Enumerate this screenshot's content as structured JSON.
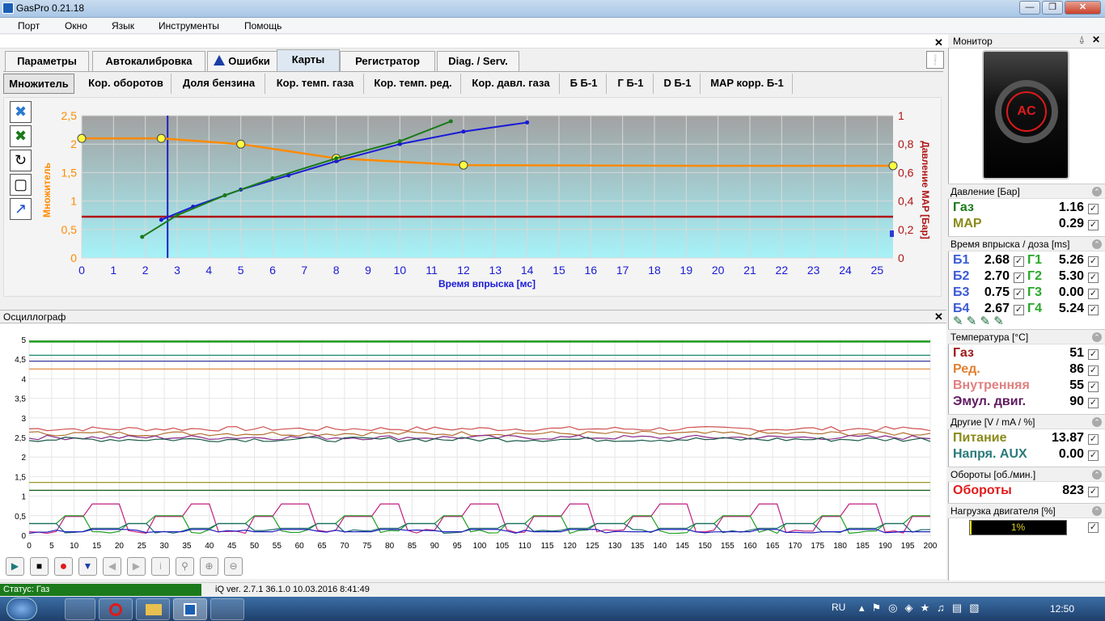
{
  "window": {
    "title": "GasPro 0.21.18"
  },
  "menu": [
    "Порт",
    "Окно",
    "Язык",
    "Инструменты",
    "Помощь"
  ],
  "main_tabs": [
    "Параметры",
    "Автокалибровка",
    "Ошибки",
    "Карты",
    "Регистратор",
    "Diag. / Serv."
  ],
  "active_main_tab": "Карты",
  "sub_tabs": [
    "Множитель",
    "Кор. оборотов",
    "Доля бензина",
    "Кор. темп. газа",
    "Кор. темп. ред.",
    "Кор. давл. газа",
    "Б Б-1",
    "Г Б-1",
    "D Б-1",
    "MAP корр. Б-1"
  ],
  "active_sub_tab": "Множитель",
  "chart_data": {
    "type": "line",
    "xlabel": "Время впрыска [мс]",
    "ylabel": "Множитель",
    "y2label": "Давление MAP [Бар]",
    "x_ticks": [
      "0",
      "1",
      "2",
      "3",
      "4",
      "5",
      "6",
      "7",
      "8",
      "9",
      "10",
      "11",
      "12",
      "13",
      "14",
      "15",
      "16",
      "17",
      "18",
      "19",
      "20",
      "21",
      "22",
      "23",
      "24",
      "25"
    ],
    "y_ticks": [
      "0",
      "0,5",
      "1",
      "1,5",
      "2",
      "2,5"
    ],
    "y2_ticks": [
      "0",
      "0,2",
      "0,4",
      "0,6",
      "0,8",
      "1"
    ],
    "xlim": [
      0,
      25.5
    ],
    "ylim": [
      0,
      2.5
    ],
    "y2lim": [
      0,
      1
    ],
    "series": [
      {
        "points": [
          [
            0,
            2.1
          ],
          [
            2.5,
            2.1
          ],
          [
            5,
            2.0
          ],
          [
            8,
            1.75
          ],
          [
            12,
            1.63
          ],
          [
            19,
            1.62
          ],
          [
            25.5,
            1.62
          ]
        ],
        "color": "#ff8a00"
      },
      {
        "points": [
          [
            2.5,
            0.67
          ],
          [
            3.5,
            0.9
          ],
          [
            5,
            1.2
          ],
          [
            6.5,
            1.45
          ],
          [
            8,
            1.7
          ],
          [
            10,
            2.0
          ],
          [
            12,
            2.22
          ],
          [
            14,
            2.38
          ]
        ],
        "color": "#1a1ad6"
      },
      {
        "points": [
          [
            1.9,
            0.37
          ],
          [
            3,
            0.75
          ],
          [
            4.5,
            1.1
          ],
          [
            6,
            1.4
          ],
          [
            8,
            1.75
          ],
          [
            10,
            2.05
          ],
          [
            11.6,
            2.4
          ]
        ],
        "color": "#1a7a1a"
      }
    ],
    "map_pressure_line": 0.29,
    "cursor_x": 2.7,
    "colors": {
      "plot_top": "#a2a2a2",
      "plot_bottom": "#a6f2f8",
      "multiplier_curve": "#ff8a00",
      "map_line": "#b01414",
      "cursor": "#2020c0"
    }
  },
  "oscillograph": {
    "title": "Осциллограф",
    "chart_data": {
      "type": "line",
      "y_ticks": [
        "0",
        "0,5",
        "1",
        "1,5",
        "2",
        "2,5",
        "3",
        "3,5",
        "4",
        "4,5",
        "5"
      ],
      "x_ticks": [
        "0",
        "5",
        "10",
        "15",
        "20",
        "25",
        "30",
        "35",
        "40",
        "45",
        "50",
        "55",
        "60",
        "65",
        "70",
        "75",
        "80",
        "85",
        "90",
        "95",
        "100",
        "105",
        "110",
        "115",
        "120",
        "125",
        "130",
        "135",
        "140",
        "145",
        "150",
        "155",
        "160",
        "165",
        "170",
        "175",
        "180",
        "185",
        "190",
        "195",
        "200"
      ],
      "xlim": [
        0,
        200
      ],
      "ylim": [
        0,
        5
      ],
      "levels": [
        {
          "y": 4.95,
          "color": "#1a9a1a"
        },
        {
          "y": 4.6,
          "color": "#1a8a6a"
        },
        {
          "y": 4.45,
          "color": "#3a3aa0"
        },
        {
          "y": 4.25,
          "color": "#e08030"
        },
        {
          "y": 2.72,
          "color": "#d05050"
        },
        {
          "y": 2.6,
          "color": "#b07030"
        },
        {
          "y": 2.5,
          "color": "#8a2a8a"
        },
        {
          "y": 2.45,
          "color": "#1a5a4a"
        },
        {
          "y": 1.35,
          "color": "#9a9a20"
        },
        {
          "y": 1.15,
          "color": "#1a5a1a"
        },
        {
          "y": 0.8,
          "color": "#c02080"
        },
        {
          "y": 0.5,
          "color": "#20a020"
        },
        {
          "y": 0.3,
          "color": "#1a6a6a"
        },
        {
          "y": 0.15,
          "color": "#2020c0"
        }
      ]
    },
    "controls": [
      "play",
      "stop",
      "record",
      "down",
      "prev",
      "next",
      "info",
      "zoom",
      "zoom-in",
      "zoom-out"
    ]
  },
  "monitor": {
    "title": "Монитор",
    "pressure": {
      "header": "Давление [Бар]",
      "items": [
        {
          "label": "Газ",
          "value": "1.16",
          "color": "#1a7a1a"
        },
        {
          "label": "MAP",
          "value": "0.29",
          "color": "#8a8a1a"
        }
      ]
    },
    "injection": {
      "header": "Время впрыска / доза [ms]",
      "rows": [
        {
          "b": "Б1",
          "bv": "2.68",
          "g": "Г1",
          "gv": "5.26"
        },
        {
          "b": "Б2",
          "bv": "2.70",
          "g": "Г2",
          "gv": "5.30"
        },
        {
          "b": "Б3",
          "bv": "0.75",
          "g": "Г3",
          "gv": "0.00"
        },
        {
          "b": "Б4",
          "bv": "2.67",
          "g": "Г4",
          "gv": "5.24"
        }
      ]
    },
    "temperature": {
      "header": "Температура [°C]",
      "items": [
        {
          "label": "Газ",
          "value": "51",
          "color": "#a01a1a"
        },
        {
          "label": "Ред.",
          "value": "86",
          "color": "#e08030"
        },
        {
          "label": "Внутренняя",
          "value": "55",
          "color": "#e08080"
        },
        {
          "label": "Эмул. двиг.",
          "value": "90",
          "color": "#601a60"
        }
      ]
    },
    "other": {
      "header": "Другие [V / mA / %]",
      "items": [
        {
          "label": "Питание",
          "value": "13.87",
          "color": "#8a8a1a"
        },
        {
          "label": "Напря. AUX",
          "value": "0.00",
          "color": "#2a7a7a"
        }
      ]
    },
    "rpm": {
      "header": "Обороты [об./мин.]",
      "label": "Обороты",
      "value": "823",
      "color": "#e01a1a"
    },
    "load": {
      "header": "Нагрузка двигателя [%]",
      "value": "1%"
    }
  },
  "status": {
    "status_text": "Статус: Газ",
    "version": "iQ  ver. 2.7.1  36.1.0  10.03.2016 8:41:49"
  },
  "taskbar": {
    "lang": "RU",
    "time": "12:50"
  }
}
